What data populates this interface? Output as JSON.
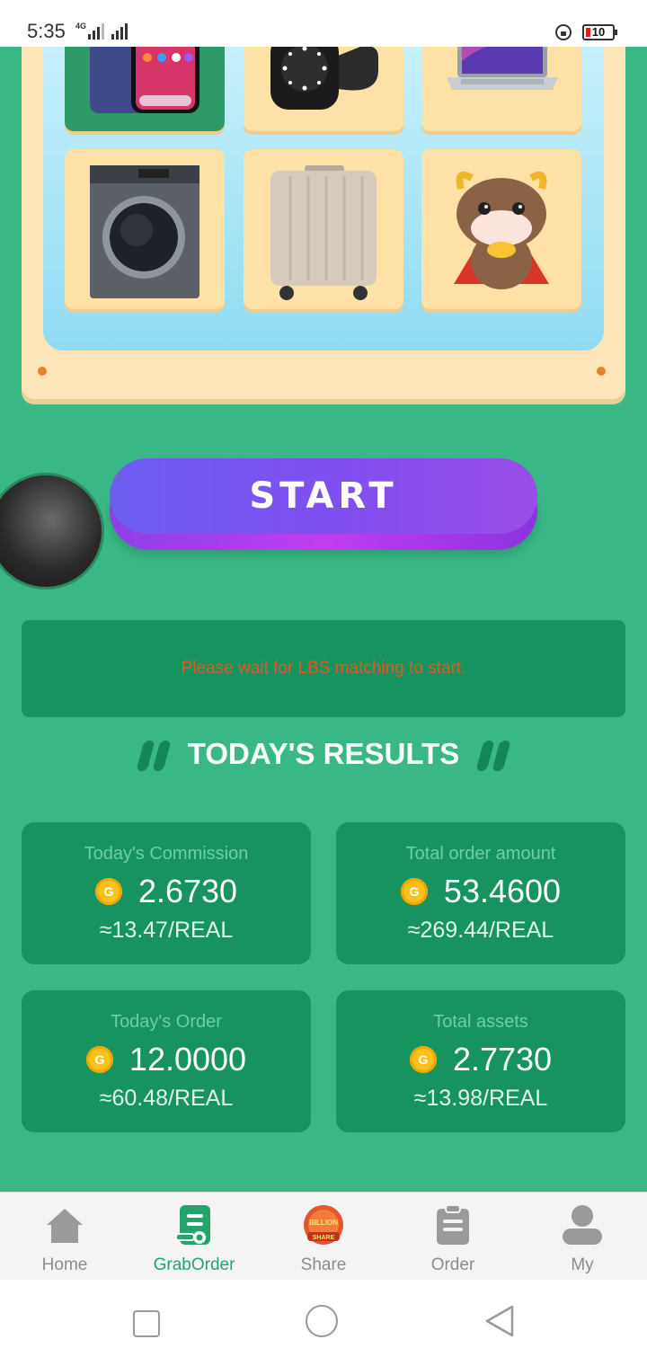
{
  "status_bar": {
    "time": "5:35",
    "network": "4G",
    "battery_level": "10",
    "battery_color": "#e02020"
  },
  "prize_grid": {
    "items": [
      {
        "icon": "smartphone-icon",
        "active": true
      },
      {
        "icon": "smartwatch-icon",
        "active": false
      },
      {
        "icon": "laptop-icon",
        "active": false
      },
      {
        "icon": "washing-machine-icon",
        "active": false
      },
      {
        "icon": "suitcase-icon",
        "active": false
      },
      {
        "icon": "cow-mascot-icon",
        "active": false
      }
    ]
  },
  "start_button": {
    "label": "START"
  },
  "message": {
    "text": "Please wait for LBS matching to start.",
    "color": "#e8571f"
  },
  "results": {
    "title": "TODAY'S RESULTS",
    "cards": [
      {
        "label": "Today's Commission",
        "value": "2.6730",
        "converted": "≈13.47/REAL"
      },
      {
        "label": "Total order amount",
        "value": "53.4600",
        "converted": "≈269.44/REAL"
      },
      {
        "label": "Today's Order",
        "value": "12.0000",
        "converted": "≈60.48/REAL"
      },
      {
        "label": "Total assets",
        "value": "2.7730",
        "converted": "≈13.98/REAL"
      }
    ]
  },
  "tabbar": {
    "tabs": [
      {
        "label": "Home",
        "icon": "home-icon",
        "active": false
      },
      {
        "label": "GrabOrder",
        "icon": "grab-order-icon",
        "active": true
      },
      {
        "label": "Share",
        "icon": "share-billion-badge-icon",
        "active": false,
        "badge_top": "BILLION",
        "badge_bottom": "SHARE"
      },
      {
        "label": "Order",
        "icon": "clipboard-icon",
        "active": false
      },
      {
        "label": "My",
        "icon": "user-icon",
        "active": false
      }
    ]
  },
  "colors": {
    "background": "#39b886",
    "card": "#16935f",
    "board": "#fde6b9",
    "accent_active_tab": "#22a56c",
    "start_button": "#7f4ff0"
  }
}
